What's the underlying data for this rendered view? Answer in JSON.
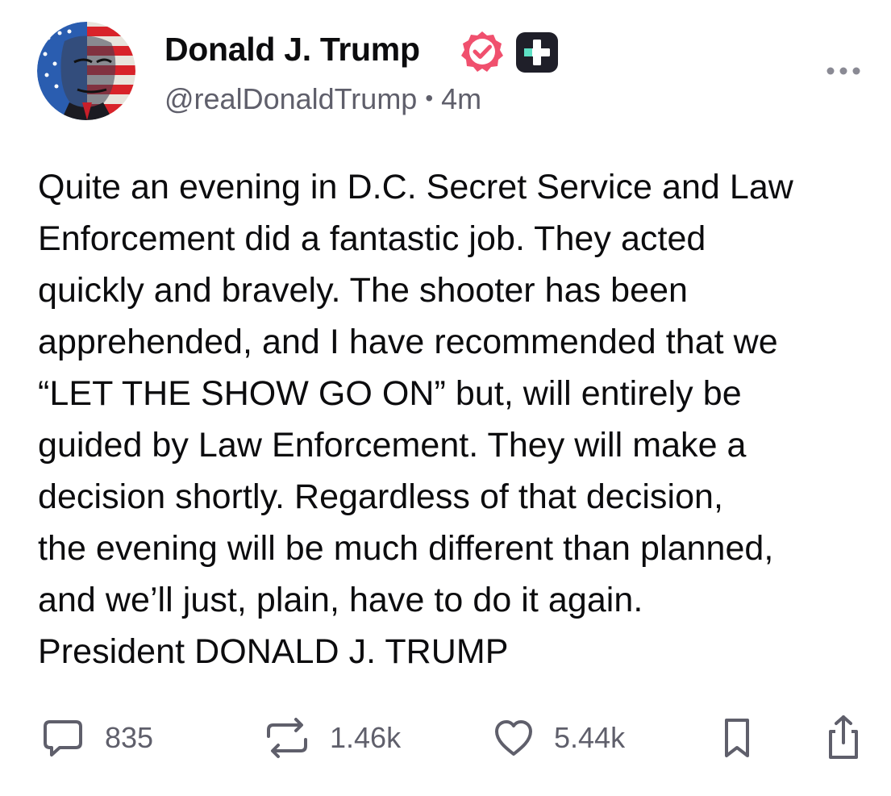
{
  "author": {
    "name": "Donald J. Trump",
    "handle": "@realDonaldTrump",
    "separator": "•",
    "time": "4m"
  },
  "post": {
    "text": "Quite an evening in D.C. Secret Service and Law\nEnforcement did a fantastic job. They acted\nquickly and bravely. The shooter has been\napprehended, and I have recommended that we\n“LET THE SHOW GO ON” but, will entirely be\nguided by Law Enforcement. They will make a\ndecision shortly. Regardless of that decision,\nthe evening will be much different than planned,\nand we’ll just, plain, have to do it again.\nPresident DONALD J. TRUMP"
  },
  "actions": {
    "replies": "835",
    "reposts": "1.46k",
    "likes": "5.44k"
  },
  "icons": {
    "verified": "verified-badge-icon",
    "plus": "plus-badge-icon",
    "more": "more-options-icon",
    "reply": "reply-bubble-icon",
    "repost": "repost-arrows-icon",
    "like": "heart-icon",
    "bookmark": "bookmark-icon",
    "share": "share-icon"
  },
  "colors": {
    "text": "#0c0c0e",
    "muted": "#5f5f6b",
    "verified": "#f0506e",
    "plus_badge": "#1f1f29",
    "plus_accent": "#5ee0c4"
  }
}
